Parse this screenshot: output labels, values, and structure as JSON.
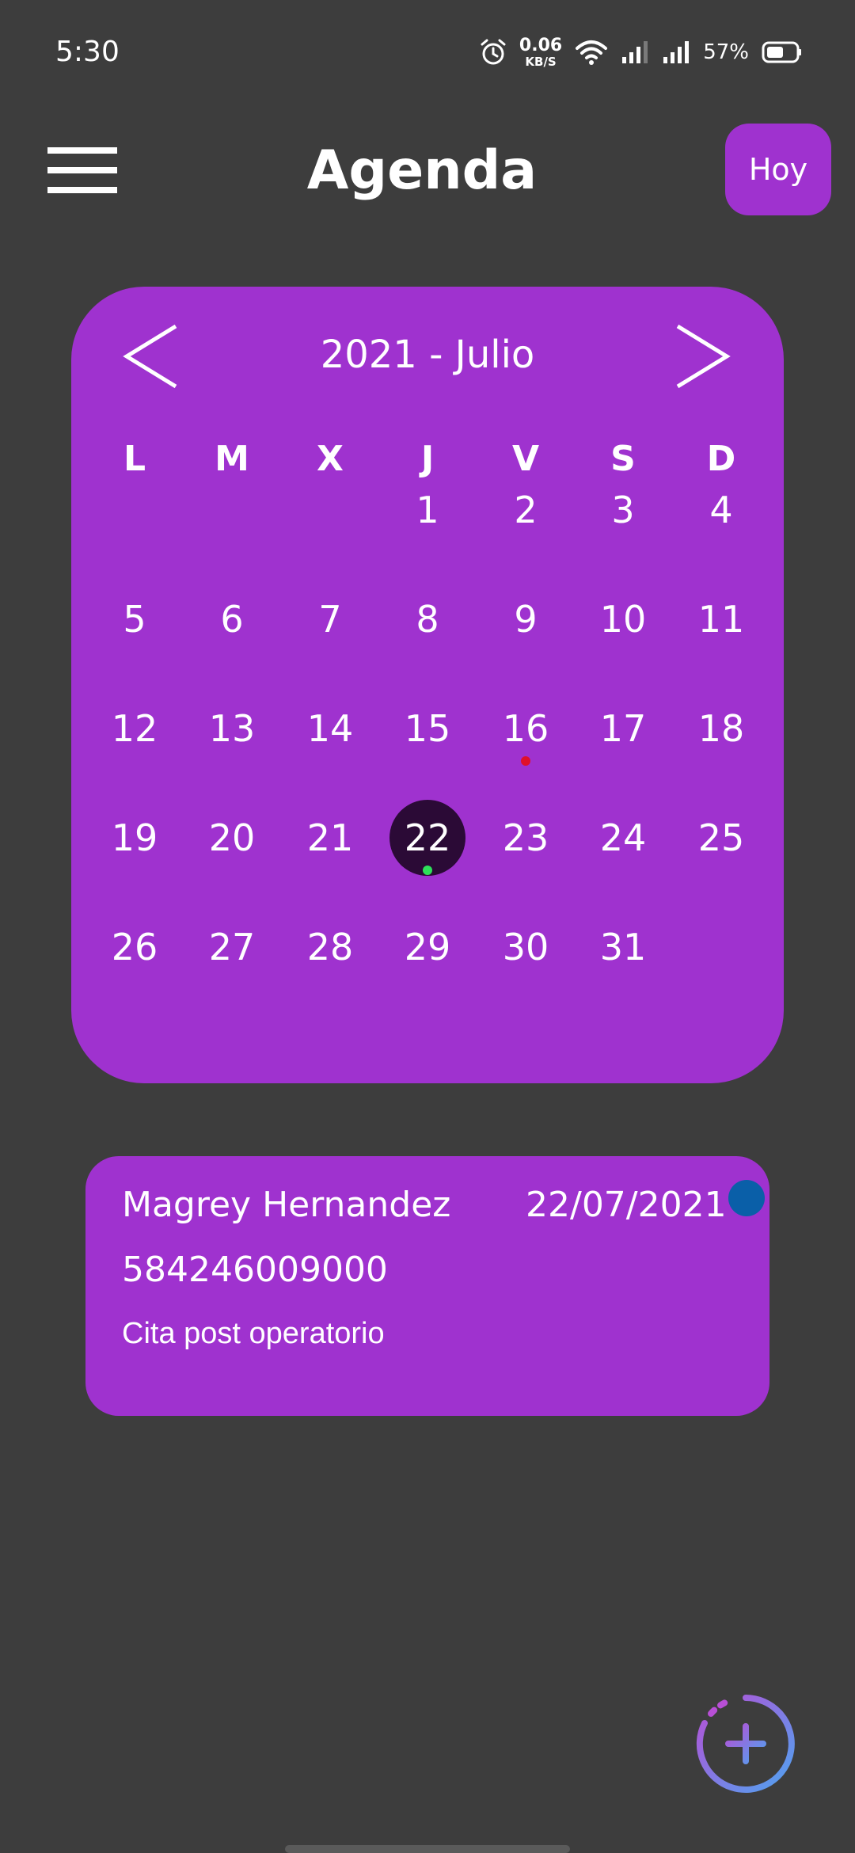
{
  "status_bar": {
    "time": "5:30",
    "net_speed_value": "0.06",
    "net_speed_unit": "KB/S",
    "battery_percent": "57%",
    "icons": [
      "alarm-icon",
      "wifi-icon",
      "signal-icon",
      "signal-icon",
      "battery-icon"
    ]
  },
  "app_bar": {
    "menu_icon": "hamburger-menu-icon",
    "title": "Agenda",
    "today_label": "Hoy"
  },
  "calendar": {
    "month_label": "2021 - Julio",
    "prev_icon": "chevron-left-icon",
    "next_icon": "chevron-right-icon",
    "weekdays": [
      "L",
      "M",
      "X",
      "J",
      "V",
      "S",
      "D"
    ],
    "weeks": [
      [
        "",
        "",
        "",
        "1",
        "2",
        "3",
        "4"
      ],
      [
        "5",
        "6",
        "7",
        "8",
        "9",
        "10",
        "11"
      ],
      [
        "12",
        "13",
        "14",
        "15",
        "16",
        "17",
        "18"
      ],
      [
        "19",
        "20",
        "21",
        "22",
        "23",
        "24",
        "25"
      ],
      [
        "26",
        "27",
        "28",
        "29",
        "30",
        "31",
        ""
      ]
    ],
    "selected_day": "22",
    "event_markers": [
      {
        "day": "16",
        "color": "#e0102a"
      },
      {
        "day": "22",
        "color": "#2ee05a"
      }
    ]
  },
  "appointment": {
    "name": "Magrey Hernandez",
    "date": "22/07/2021",
    "phone": "584246009000",
    "note": "Cita post operatorio",
    "status_color": "#0a5fa8"
  },
  "fab": {
    "icon": "add-icon"
  },
  "colors": {
    "background": "#3d3d3d",
    "accent": "#9f32cf",
    "selected_day_bg": "#2b0a36"
  }
}
